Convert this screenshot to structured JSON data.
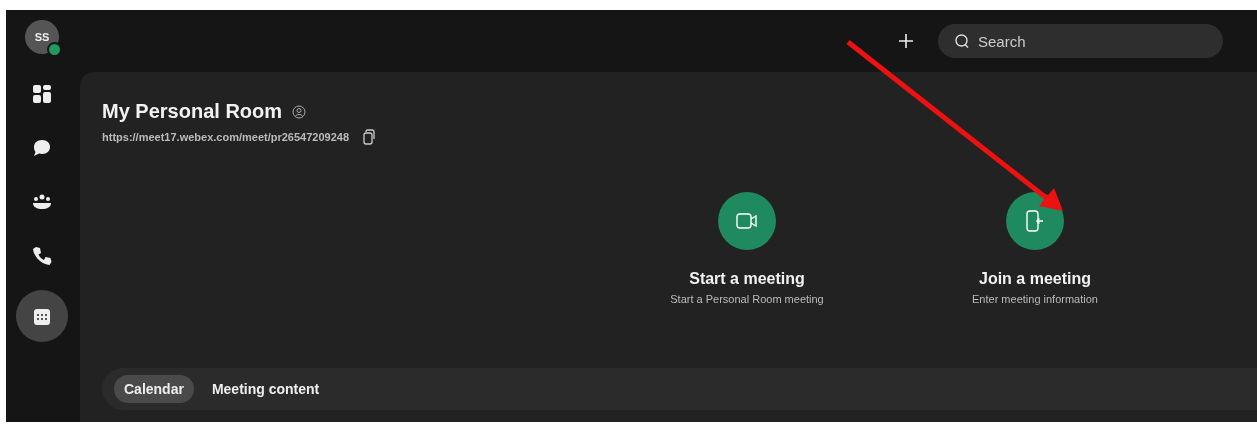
{
  "user": {
    "initials": "SS"
  },
  "sidebar": {
    "items": [
      {
        "kind": "apps",
        "selected": false
      },
      {
        "kind": "chat",
        "selected": false
      },
      {
        "kind": "teams",
        "selected": false
      },
      {
        "kind": "calls",
        "selected": false
      },
      {
        "kind": "calendar",
        "selected": true
      }
    ]
  },
  "search": {
    "placeholder": "Search"
  },
  "room": {
    "title": "My Personal Room",
    "url": "https://meet17.webex.com/meet/pr26547209248"
  },
  "actions": [
    {
      "kind": "start",
      "title": "Start a meeting",
      "subtitle": "Start a Personal Room meeting"
    },
    {
      "kind": "join",
      "title": "Join a meeting",
      "subtitle": "Enter meeting information"
    }
  ],
  "tabs": [
    {
      "label": "Calendar",
      "selected": true
    },
    {
      "label": "Meeting content",
      "selected": false
    }
  ]
}
